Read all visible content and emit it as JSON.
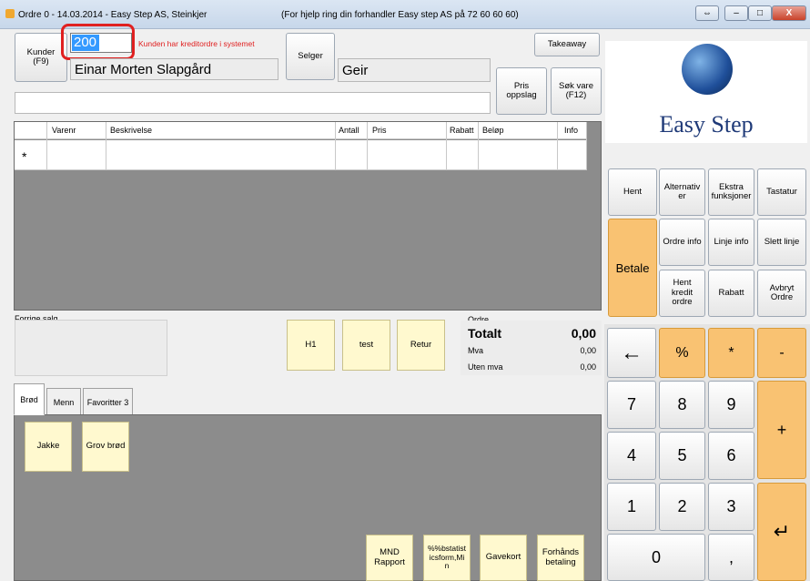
{
  "window": {
    "title_left": "Ordre 0 - 14.03.2014 - Easy Step AS, Steinkjer",
    "title_help": "(For hjelp ring din forhandler Easy step AS  på 72 60 60 60)",
    "min_label": "–",
    "max_label": "□",
    "close_label": "X"
  },
  "customer": {
    "kunder_label": "Kunder\n(F9)",
    "number_value": "200",
    "warning": "Kunden har kreditordre i systemet",
    "name": "Einar Morten Slapgård"
  },
  "seller": {
    "label": "Selger",
    "name": "Geir"
  },
  "toolbar": {
    "takeaway": "Takeaway",
    "pris_oppslag": "Pris\noppslag",
    "sok_vare": "Søk vare\n(F12)"
  },
  "grid": {
    "columns": [
      "Varenr",
      "Beskrivelse",
      "Antall",
      "Pris",
      "Rabatt",
      "Beløp",
      "Info"
    ],
    "new_row_marker": "*"
  },
  "brand": {
    "name": "Easy Step"
  },
  "function_buttons": {
    "hent": "Hent",
    "alternativer": "Alternativ\ner",
    "ekstra": "Ekstra\nfunksjoner",
    "tastatur": "Tastatur",
    "betale": "Betale",
    "ordre_info": "Ordre info",
    "linje_info": "Linje info",
    "slett_linje": "Slett linje",
    "hent_kredit": "Hent\nkredit\nordre",
    "rabatt": "Rabatt",
    "avbryt": "Avbryt\nOrdre"
  },
  "previous_sales": {
    "label": "Forrige salg"
  },
  "quick_buttons": [
    "H1",
    "test",
    "Retur"
  ],
  "totals": {
    "heading": "Ordre",
    "total_label": "Totalt",
    "total_value": "0,00",
    "mva_label": "Mva",
    "mva_value": "0,00",
    "uten_label": "Uten mva",
    "uten_value": "0,00"
  },
  "tabs": [
    "Brød",
    "Menn",
    "Favoritter 3"
  ],
  "products": [
    "Jakke",
    "Grov brød"
  ],
  "bottom_buttons": [
    "MND\nRapport",
    "%%bstatist\nicsform,Mi\nn",
    "Gavekort",
    "Forhånds\nbetaling"
  ],
  "keypad": {
    "backspace": "←",
    "percent": "%",
    "multiply": "*",
    "minus": "-",
    "plus": "+",
    "enter": "↵",
    "keys": [
      "7",
      "8",
      "9",
      "4",
      "5",
      "6",
      "1",
      "2",
      "3",
      "0",
      ","
    ]
  },
  "colors": {
    "accent_orange": "#f9c272",
    "highlight_red": "#e02020",
    "grid_gray": "#8c8c8c",
    "brand_blue": "#1f3a78"
  }
}
